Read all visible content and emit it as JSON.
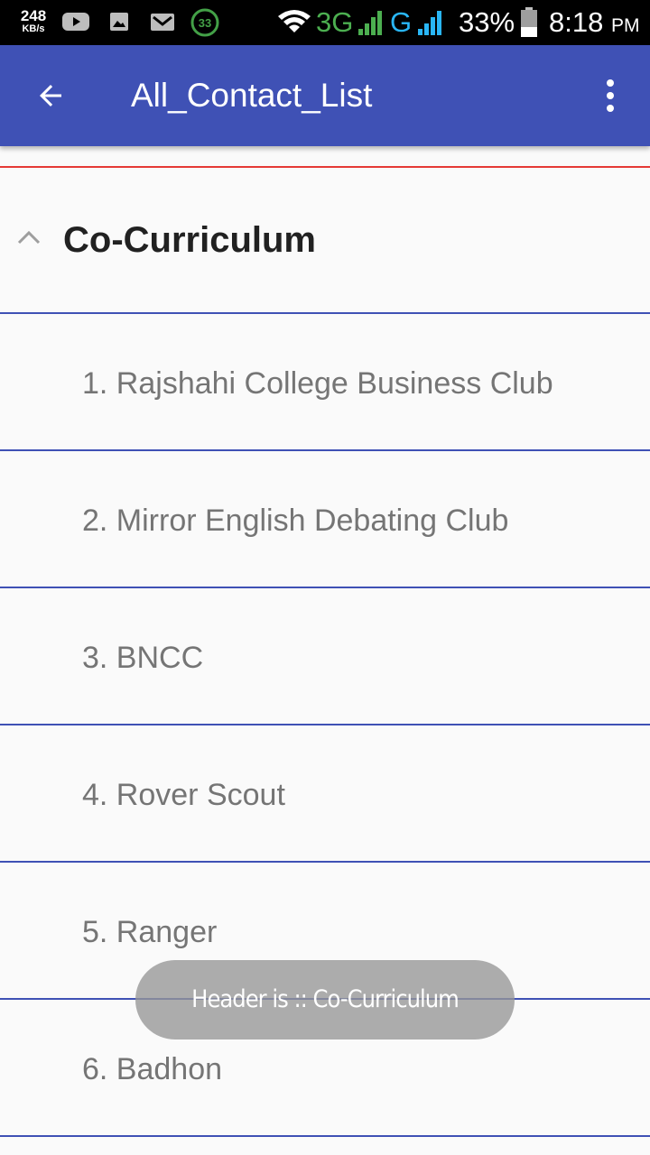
{
  "status_bar": {
    "speed_value": "248",
    "speed_unit": "KB/s",
    "notification_badge": "33",
    "network_3g": "3G",
    "network_g": "G",
    "battery": "33%",
    "time": "8:18",
    "time_suffix": "PM",
    "colors": {
      "network_3g": "#4caf50",
      "network_g": "#29b6f6"
    }
  },
  "app_bar": {
    "title": "All_Contact_List",
    "back_icon": "arrow-back-icon",
    "menu_icon": "more-vert-icon",
    "color": "#3f51b5"
  },
  "group": {
    "title": "Co-Curriculum",
    "expanded": true,
    "items": [
      {
        "label": "1. Rajshahi College Business Club"
      },
      {
        "label": "2. Mirror English Debating Club"
      },
      {
        "label": "3. BNCC"
      },
      {
        "label": "4. Rover Scout"
      },
      {
        "label": "5. Ranger"
      },
      {
        "label": "6. Badhon"
      }
    ]
  },
  "toast": {
    "text": "Header is :: Co-Curriculum"
  }
}
